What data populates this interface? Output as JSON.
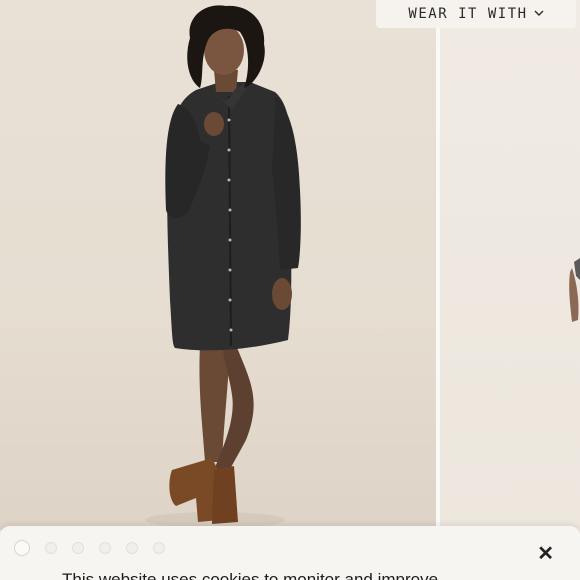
{
  "header": {
    "wear_it_with_label": "WEAR IT WITH"
  },
  "icons": {
    "dropdown": "chevron-down-icon",
    "close": "close-icon"
  },
  "cookie_banner": {
    "message": "This website uses cookies to monitor and improve",
    "close_symbol": "✕"
  },
  "carousel": {
    "slide_count": 6,
    "active_index": 0
  },
  "product_image": {
    "description_colors": {
      "dress": "#2b2b2b",
      "boots": "#7a4a26",
      "background": "#e6ddd1"
    }
  }
}
